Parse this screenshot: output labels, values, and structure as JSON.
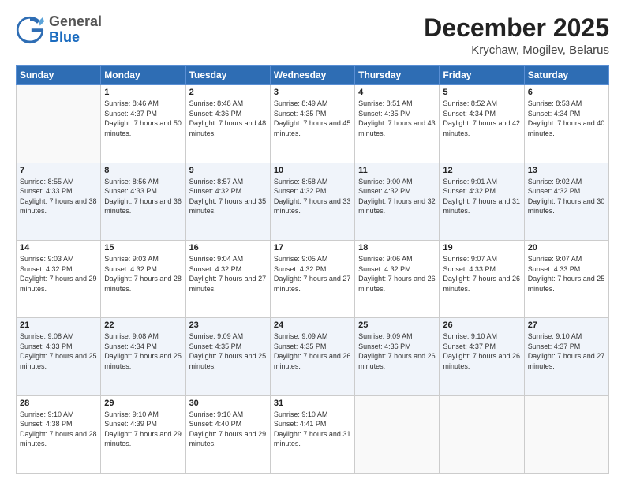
{
  "header": {
    "logo": {
      "general": "General",
      "blue": "Blue"
    },
    "title": "December 2025",
    "location": "Krychaw, Mogilev, Belarus"
  },
  "weekdays": [
    "Sunday",
    "Monday",
    "Tuesday",
    "Wednesday",
    "Thursday",
    "Friday",
    "Saturday"
  ],
  "weeks": [
    [
      {
        "day": "",
        "empty": true
      },
      {
        "day": "1",
        "sunrise": "8:46 AM",
        "sunset": "4:37 PM",
        "daylight": "7 hours and 50 minutes."
      },
      {
        "day": "2",
        "sunrise": "8:48 AM",
        "sunset": "4:36 PM",
        "daylight": "7 hours and 48 minutes."
      },
      {
        "day": "3",
        "sunrise": "8:49 AM",
        "sunset": "4:35 PM",
        "daylight": "7 hours and 45 minutes."
      },
      {
        "day": "4",
        "sunrise": "8:51 AM",
        "sunset": "4:35 PM",
        "daylight": "7 hours and 43 minutes."
      },
      {
        "day": "5",
        "sunrise": "8:52 AM",
        "sunset": "4:34 PM",
        "daylight": "7 hours and 42 minutes."
      },
      {
        "day": "6",
        "sunrise": "8:53 AM",
        "sunset": "4:34 PM",
        "daylight": "7 hours and 40 minutes."
      }
    ],
    [
      {
        "day": "7",
        "sunrise": "8:55 AM",
        "sunset": "4:33 PM",
        "daylight": "7 hours and 38 minutes."
      },
      {
        "day": "8",
        "sunrise": "8:56 AM",
        "sunset": "4:33 PM",
        "daylight": "7 hours and 36 minutes."
      },
      {
        "day": "9",
        "sunrise": "8:57 AM",
        "sunset": "4:32 PM",
        "daylight": "7 hours and 35 minutes."
      },
      {
        "day": "10",
        "sunrise": "8:58 AM",
        "sunset": "4:32 PM",
        "daylight": "7 hours and 33 minutes."
      },
      {
        "day": "11",
        "sunrise": "9:00 AM",
        "sunset": "4:32 PM",
        "daylight": "7 hours and 32 minutes."
      },
      {
        "day": "12",
        "sunrise": "9:01 AM",
        "sunset": "4:32 PM",
        "daylight": "7 hours and 31 minutes."
      },
      {
        "day": "13",
        "sunrise": "9:02 AM",
        "sunset": "4:32 PM",
        "daylight": "7 hours and 30 minutes."
      }
    ],
    [
      {
        "day": "14",
        "sunrise": "9:03 AM",
        "sunset": "4:32 PM",
        "daylight": "7 hours and 29 minutes."
      },
      {
        "day": "15",
        "sunrise": "9:03 AM",
        "sunset": "4:32 PM",
        "daylight": "7 hours and 28 minutes."
      },
      {
        "day": "16",
        "sunrise": "9:04 AM",
        "sunset": "4:32 PM",
        "daylight": "7 hours and 27 minutes."
      },
      {
        "day": "17",
        "sunrise": "9:05 AM",
        "sunset": "4:32 PM",
        "daylight": "7 hours and 27 minutes."
      },
      {
        "day": "18",
        "sunrise": "9:06 AM",
        "sunset": "4:32 PM",
        "daylight": "7 hours and 26 minutes."
      },
      {
        "day": "19",
        "sunrise": "9:07 AM",
        "sunset": "4:33 PM",
        "daylight": "7 hours and 26 minutes."
      },
      {
        "day": "20",
        "sunrise": "9:07 AM",
        "sunset": "4:33 PM",
        "daylight": "7 hours and 25 minutes."
      }
    ],
    [
      {
        "day": "21",
        "sunrise": "9:08 AM",
        "sunset": "4:33 PM",
        "daylight": "7 hours and 25 minutes."
      },
      {
        "day": "22",
        "sunrise": "9:08 AM",
        "sunset": "4:34 PM",
        "daylight": "7 hours and 25 minutes."
      },
      {
        "day": "23",
        "sunrise": "9:09 AM",
        "sunset": "4:35 PM",
        "daylight": "7 hours and 25 minutes."
      },
      {
        "day": "24",
        "sunrise": "9:09 AM",
        "sunset": "4:35 PM",
        "daylight": "7 hours and 26 minutes."
      },
      {
        "day": "25",
        "sunrise": "9:09 AM",
        "sunset": "4:36 PM",
        "daylight": "7 hours and 26 minutes."
      },
      {
        "day": "26",
        "sunrise": "9:10 AM",
        "sunset": "4:37 PM",
        "daylight": "7 hours and 26 minutes."
      },
      {
        "day": "27",
        "sunrise": "9:10 AM",
        "sunset": "4:37 PM",
        "daylight": "7 hours and 27 minutes."
      }
    ],
    [
      {
        "day": "28",
        "sunrise": "9:10 AM",
        "sunset": "4:38 PM",
        "daylight": "7 hours and 28 minutes."
      },
      {
        "day": "29",
        "sunrise": "9:10 AM",
        "sunset": "4:39 PM",
        "daylight": "7 hours and 29 minutes."
      },
      {
        "day": "30",
        "sunrise": "9:10 AM",
        "sunset": "4:40 PM",
        "daylight": "7 hours and 29 minutes."
      },
      {
        "day": "31",
        "sunrise": "9:10 AM",
        "sunset": "4:41 PM",
        "daylight": "7 hours and 31 minutes."
      },
      {
        "day": "",
        "empty": true
      },
      {
        "day": "",
        "empty": true
      },
      {
        "day": "",
        "empty": true
      }
    ]
  ],
  "labels": {
    "sunrise": "Sunrise:",
    "sunset": "Sunset:",
    "daylight": "Daylight:"
  }
}
